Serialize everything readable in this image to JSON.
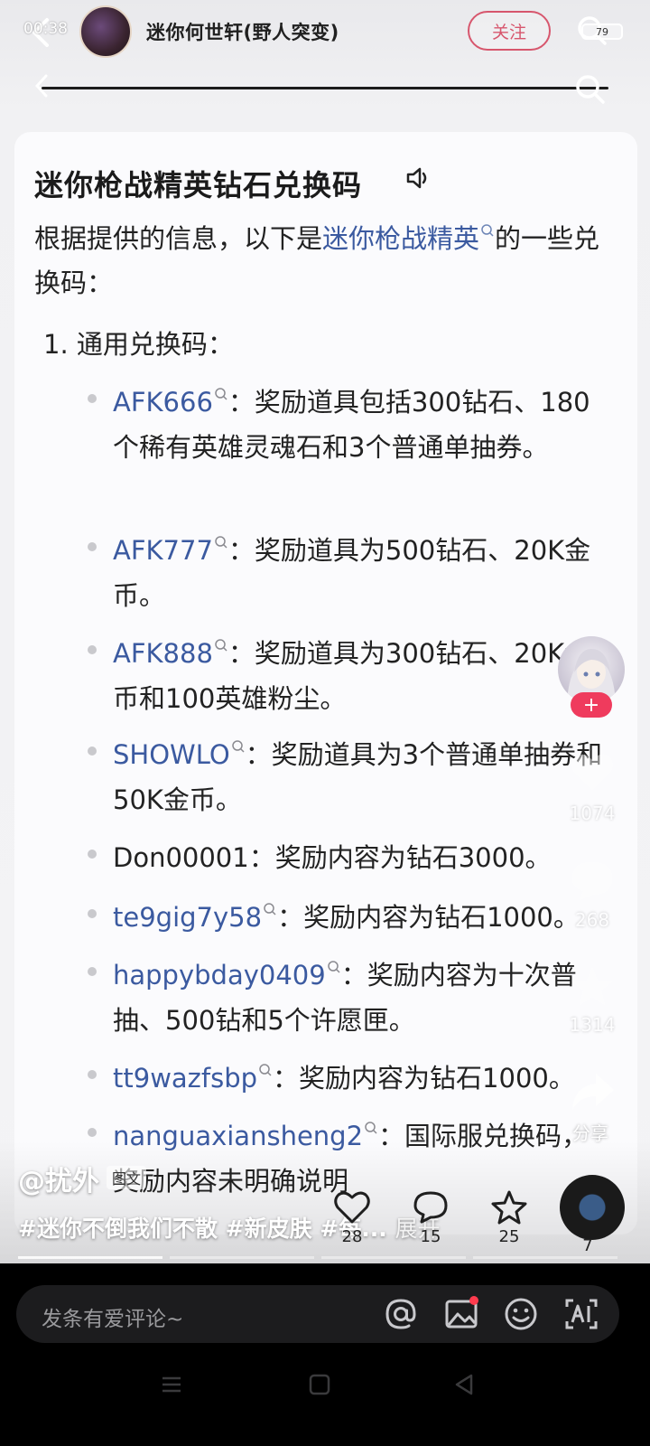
{
  "status": {
    "time": "00:38",
    "battery": "79"
  },
  "author": {
    "name": "迷你何世轩(野人突变)",
    "follow_label": "关注"
  },
  "card": {
    "title": "迷你枪战精英钻石兑换码",
    "intro_before": "根据提供的信息，以下是",
    "intro_link": "迷你枪战精英",
    "intro_after": "的一些兑换码：",
    "list_heading": "1. 通用兑换码：",
    "items": [
      {
        "code": "AFK666",
        "linked": true,
        "text": "：奖励道具包括300钻石、180个稀有英雄灵魂石和3个普通单抽券。"
      },
      {
        "code": "AFK777",
        "linked": true,
        "text": "：奖励道具为500钻石、20K金币。"
      },
      {
        "code": "AFK888",
        "linked": true,
        "text": "：奖励道具为300钻石、20K金币和100英雄粉尘。"
      },
      {
        "code": "SHOWLO",
        "linked": true,
        "text": "：奖励道具为3个普通单抽券和50K金币。"
      },
      {
        "code": "Don00001",
        "linked": false,
        "text": "：奖励内容为钻石3000。"
      },
      {
        "code": "te9gig7y58",
        "linked": true,
        "text": "：奖励内容为钻石1000。"
      },
      {
        "code": "happybday0409",
        "linked": true,
        "text": "：奖励内容为十次普抽、500钻和5个许愿匣。"
      },
      {
        "code": "tt9wazfsbp",
        "linked": true,
        "text": "：奖励内容为钻石1000。"
      },
      {
        "code": "nanguaxiansheng2",
        "linked": true,
        "text": "：国际服兑换码，奖励内容未明确说明"
      }
    ]
  },
  "side": {
    "like_count": "1074",
    "comment_count": "268",
    "fav_count": "1314",
    "share_label": "分享"
  },
  "post": {
    "handle": "@扰外",
    "handle_badge": "图文",
    "hashtags": "#迷你不倒我们不散 #新皮肤 #每...",
    "expand_label": "展开"
  },
  "actions": {
    "likes": "28",
    "comments": "15",
    "favorites": "25",
    "music": "7"
  },
  "comment_bar": {
    "placeholder": "发条有爱评论~"
  },
  "colors": {
    "accent": "#d7566d",
    "link": "#3b5aa0",
    "badge_red": "#ef3b5d"
  }
}
